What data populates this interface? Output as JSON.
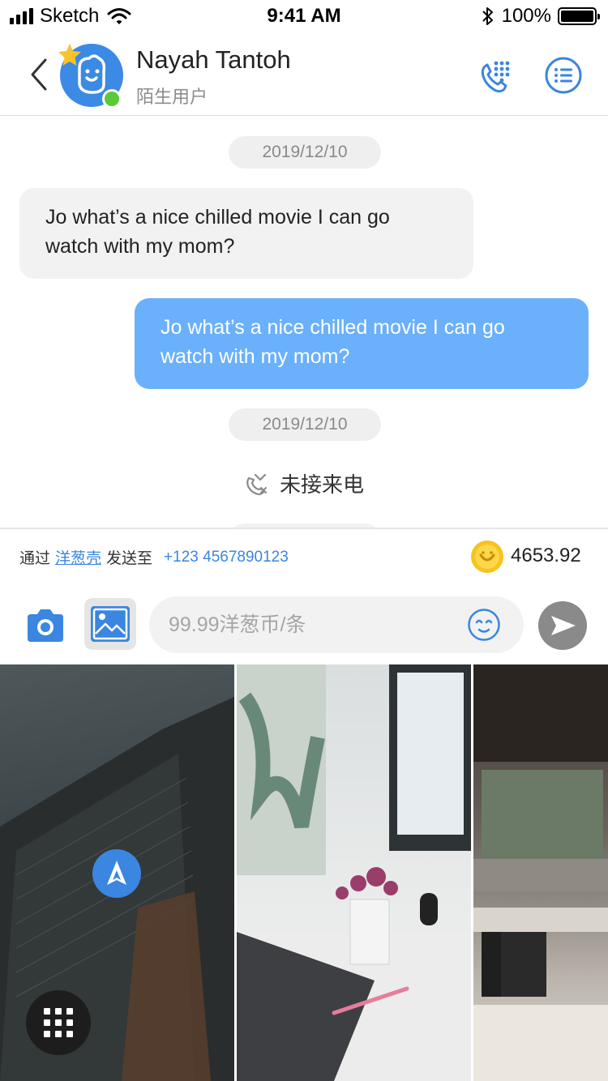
{
  "status_bar": {
    "carrier": "Sketch",
    "time": "9:41 AM",
    "battery": "100%"
  },
  "header": {
    "contact_name": "Nayah Tantoh",
    "contact_subtitle": "陌生用户"
  },
  "chat": {
    "messages": [
      {
        "type": "date",
        "text": "2019/12/10"
      },
      {
        "type": "incoming",
        "text": "Jo what’s a nice chilled movie I can go watch with my mom?"
      },
      {
        "type": "outgoing",
        "text": "Jo what’s a nice chilled movie I can go watch with my mom?"
      },
      {
        "type": "date",
        "text": "2019/12/10"
      },
      {
        "type": "call",
        "text": "未接来电"
      }
    ]
  },
  "send_info": {
    "via_label": "通过",
    "via_link": "洋葱壳",
    "send_to_label": "发送至",
    "phone": "+123 4567890123",
    "coin_balance": "4653.92"
  },
  "input": {
    "placeholder": "99.99洋葱币/条",
    "value": ""
  },
  "colors": {
    "accent": "#3a86e0",
    "outgoing_bubble": "#6ab0fb",
    "incoming_bubble": "#f2f2f2",
    "online": "#5cc83a"
  },
  "icons": {
    "back": "chevron-left-icon",
    "star": "star-icon",
    "call": "phone-dialpad-icon",
    "menu": "list-icon",
    "missed_call": "missed-call-icon",
    "coin": "coin-icon",
    "camera": "camera-icon",
    "image": "image-icon",
    "emoji": "emoji-icon",
    "send": "send-icon",
    "compass": "navigation-icon",
    "grid": "grid-icon"
  }
}
